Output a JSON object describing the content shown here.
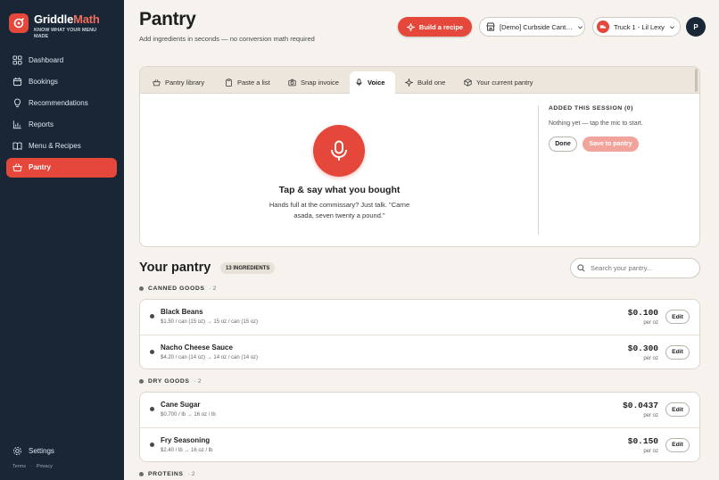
{
  "brand": {
    "name_part1": "Griddle",
    "name_part2": "Math",
    "tagline": "KNOW WHAT YOUR MENU MADE"
  },
  "sidebar": {
    "items": [
      {
        "label": "Dashboard",
        "icon": "grid-icon",
        "active": false
      },
      {
        "label": "Bookings",
        "icon": "calendar-icon",
        "active": false
      },
      {
        "label": "Recommendations",
        "icon": "lightbulb-icon",
        "active": false
      },
      {
        "label": "Reports",
        "icon": "bar-chart-icon",
        "active": false
      },
      {
        "label": "Menu & Recipes",
        "icon": "book-icon",
        "active": false
      },
      {
        "label": "Pantry",
        "icon": "basket-icon",
        "active": true
      }
    ],
    "settings_label": "Settings",
    "terms_label": "Terms",
    "privacy_label": "Privacy",
    "separator": "·"
  },
  "header": {
    "title": "Pantry",
    "subtitle": "Add ingredients in seconds — no conversion math required",
    "build_recipe_label": "Build a recipe",
    "venue_select": "[Demo] Curbside Cantina",
    "truck_select": "Truck 1 - Lil Lexy",
    "avatar_initial": "P"
  },
  "capture": {
    "tabs": [
      {
        "label": "Pantry library",
        "icon": "basket-icon",
        "active": false
      },
      {
        "label": "Paste a list",
        "icon": "clipboard-icon",
        "active": false
      },
      {
        "label": "Snap invoice",
        "icon": "camera-icon",
        "active": false
      },
      {
        "label": "Voice",
        "icon": "mic-icon",
        "active": true
      },
      {
        "label": "Build one",
        "icon": "sparkle-icon",
        "active": false
      },
      {
        "label": "Your current pantry",
        "icon": "box-icon",
        "active": false
      }
    ],
    "voice_title": "Tap & say what you bought",
    "voice_subtitle": "Hands full at the commissary? Just talk. \"Carne asada, seven twenty a pound.\"",
    "session_heading": "ADDED THIS SESSION (0)",
    "session_empty": "Nothing yet — tap the mic to start.",
    "done_label": "Done",
    "save_label": "Save to pantry"
  },
  "pantry": {
    "title": "Your pantry",
    "count_badge": "13 INGREDIENTS",
    "search_placeholder": "Search your pantry...",
    "categories": [
      {
        "name": "CANNED GOODS",
        "count": "· 2",
        "items": [
          {
            "name": "Black Beans",
            "meta": "$1.50 / can (15 oz) → 15 oz / can (15 oz)",
            "price": "$0.100",
            "unit": "per oz",
            "edit": "Edit"
          },
          {
            "name": "Nacho Cheese Sauce",
            "meta": "$4.20 / can (14 oz) → 14 oz / can (14 oz)",
            "price": "$0.300",
            "unit": "per oz",
            "edit": "Edit"
          }
        ]
      },
      {
        "name": "DRY GOODS",
        "count": "· 2",
        "items": [
          {
            "name": "Cane Sugar",
            "meta": "$0.700 / lb → 16 oz / lb",
            "price": "$0.0437",
            "unit": "per oz",
            "edit": "Edit"
          },
          {
            "name": "Fry Seasoning",
            "meta": "$2.40 / lb → 16 oz / lb",
            "price": "$0.150",
            "unit": "per oz",
            "edit": "Edit"
          }
        ]
      },
      {
        "name": "PROTEINS",
        "count": "· 2",
        "items": []
      }
    ]
  },
  "colors": {
    "accent": "#e5473a",
    "sidebar_bg": "#182636",
    "page_bg": "#f6f3ee"
  }
}
